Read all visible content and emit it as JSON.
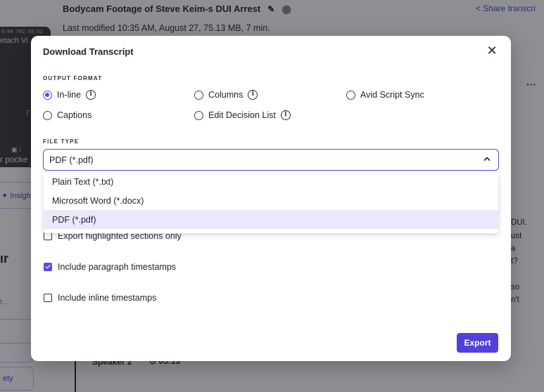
{
  "background": {
    "video": {
      "timecode": "0:04 T02:45:52",
      "detach_label": "etach Vi",
      "time_fragment": "7",
      "pocket_label": "r pocke"
    },
    "title": "Bodycam Footage of Steve Keim-s DUI Arrest",
    "meta": "Last modified 10:35 AM, August 27, 75.13 MB, 7 min.",
    "share_label": "Share transcri",
    "more_label": "···",
    "insight_label": "Insigh",
    "heading_fragment": "ır",
    "ellipsis_fragment": "t...",
    "variety_fragment": "ety",
    "speaker": "Speaker 2",
    "timestamp": "05:13",
    "right_text": [
      "DUI.",
      "ust",
      "a",
      "t?",
      "so",
      "n't"
    ]
  },
  "modal": {
    "title": "Download Transcript",
    "output_format": {
      "label": "OUTPUT FORMAT",
      "options": [
        {
          "label": "In-line",
          "checked": true,
          "info": true
        },
        {
          "label": "Columns",
          "checked": false,
          "info": true
        },
        {
          "label": "Avid Script Sync",
          "checked": false,
          "info": false
        },
        {
          "label": "Captions",
          "checked": false,
          "info": false
        },
        {
          "label": "Edit Decision List",
          "checked": false,
          "info": true
        }
      ]
    },
    "file_type": {
      "label": "FILE TYPE",
      "selected": "PDF (*.pdf)",
      "options": [
        "Plain Text (*.txt)",
        "Microsoft Word (*.docx)",
        "PDF (*.pdf)"
      ]
    },
    "checkboxes": {
      "highlighted_only": {
        "label": "Export highlighted sections only",
        "checked": false
      },
      "paragraph_timestamps": {
        "label": "Include paragraph timestamps",
        "checked": true
      },
      "inline_timestamps": {
        "label": "Include inline timestamps",
        "checked": false
      }
    },
    "export_label": "Export",
    "info_glyph": "i"
  },
  "colors": {
    "accent": "#5b4be0",
    "accent_dark": "#5140dc",
    "selected_option_bg": "#ebe8fb",
    "overlay": "rgba(18,20,30,0.48)"
  }
}
